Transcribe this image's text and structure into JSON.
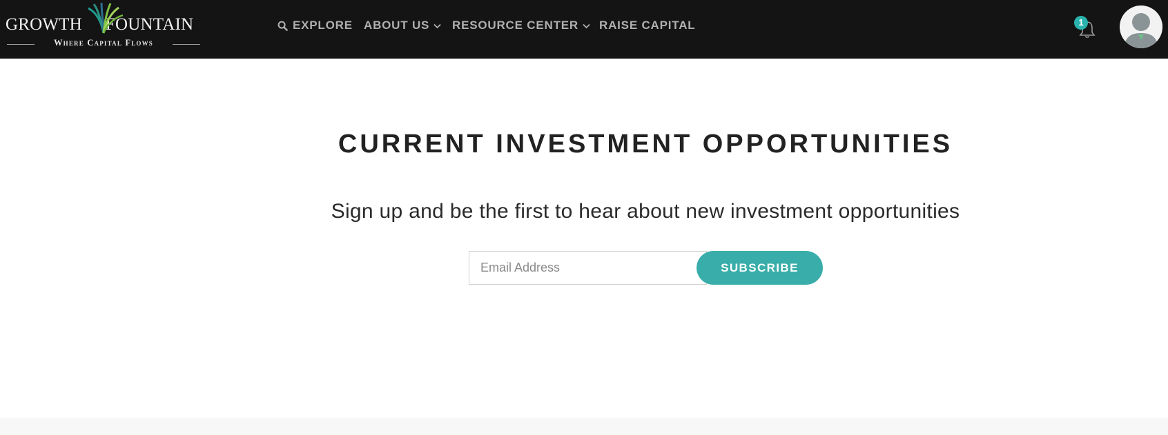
{
  "brand": {
    "name_left": "GROWTH",
    "name_right": "FOUNTAIN",
    "tagline": "Where Capital Flows",
    "palm_colors": [
      "#1f9c8f",
      "#7cc143",
      "#2d6f8f"
    ]
  },
  "nav": {
    "explore": {
      "label": "EXPLORE",
      "icon": "search-icon"
    },
    "about": {
      "label": "ABOUT US",
      "icon": "chevron-down-icon"
    },
    "resource": {
      "label": "RESOURCE CENTER",
      "icon": "chevron-down-icon"
    },
    "raise": {
      "label": "RAISE CAPITAL"
    }
  },
  "notifications": {
    "count": "1",
    "icon": "bell-icon",
    "badge_color": "#2ab3ae"
  },
  "user": {
    "icon": "user-avatar-icon"
  },
  "main": {
    "title": "CURRENT INVESTMENT OPPORTUNITIES",
    "subtitle": "Sign up and be the first to hear about new investment opportunities",
    "email_placeholder": "Email Address",
    "email_value": "",
    "subscribe_label": "SUBSCRIBE",
    "accent_color": "#38ada9"
  }
}
